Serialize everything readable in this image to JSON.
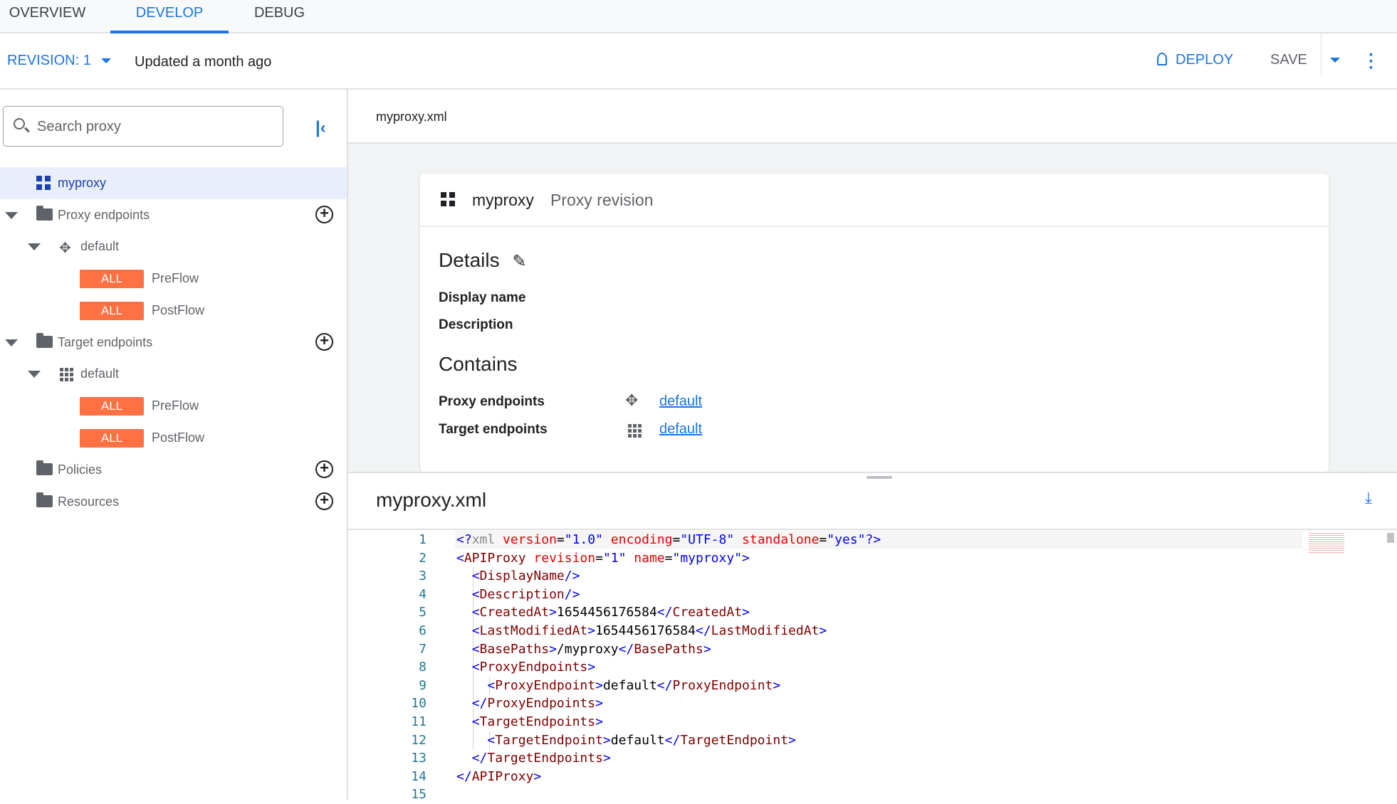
{
  "tabs": [
    {
      "label": "OVERVIEW"
    },
    {
      "label": "DEVELOP",
      "active": true
    },
    {
      "label": "DEBUG"
    }
  ],
  "header": {
    "revision": "REVISION: 1",
    "updated": "Updated a month ago",
    "deploy": "DEPLOY",
    "save": "SAVE"
  },
  "sidebar": {
    "search_placeholder": "Search proxy",
    "root": "myproxy",
    "proxy_endpoints": "Proxy endpoints",
    "proxy_default": "default",
    "target_endpoints": "Target endpoints",
    "target_default": "default",
    "badge": "ALL",
    "preflow": "PreFlow",
    "postflow": "PostFlow",
    "policies": "Policies",
    "resources": "Resources"
  },
  "file_tab": "myproxy.xml",
  "card": {
    "name": "myproxy",
    "subtitle": "Proxy revision",
    "details": "Details",
    "display_name": "Display name",
    "description": "Description",
    "contains": "Contains",
    "proxy_endpoints": "Proxy endpoints",
    "proxy_link": "default",
    "target_endpoints": "Target endpoints",
    "target_link": "default"
  },
  "editor": {
    "title": "myproxy.xml",
    "lines": [
      [
        [
          "d",
          "<?"
        ],
        [
          "p",
          "xml "
        ],
        [
          "a",
          "version"
        ],
        [
          "x",
          "="
        ],
        [
          "v",
          "\"1.0\""
        ],
        [
          "x",
          " "
        ],
        [
          "a",
          "encoding"
        ],
        [
          "x",
          "="
        ],
        [
          "v",
          "\"UTF-8\""
        ],
        [
          "x",
          " "
        ],
        [
          "a",
          "standalone"
        ],
        [
          "x",
          "="
        ],
        [
          "v",
          "\"yes\""
        ],
        [
          "d",
          "?>"
        ]
      ],
      [
        [
          "d",
          "<"
        ],
        [
          "t",
          "APIProxy "
        ],
        [
          "a",
          "revision"
        ],
        [
          "x",
          "="
        ],
        [
          "v",
          "\"1\""
        ],
        [
          "x",
          " "
        ],
        [
          "a",
          "name"
        ],
        [
          "x",
          "="
        ],
        [
          "v",
          "\"myproxy\""
        ],
        [
          "d",
          ">"
        ]
      ],
      [
        [
          "x",
          "  "
        ],
        [
          "d",
          "<"
        ],
        [
          "t",
          "DisplayName"
        ],
        [
          "d",
          "/>"
        ]
      ],
      [
        [
          "x",
          "  "
        ],
        [
          "d",
          "<"
        ],
        [
          "t",
          "Description"
        ],
        [
          "d",
          "/>"
        ]
      ],
      [
        [
          "x",
          "  "
        ],
        [
          "d",
          "<"
        ],
        [
          "t",
          "CreatedAt"
        ],
        [
          "d",
          ">"
        ],
        [
          "x",
          "1654456176584"
        ],
        [
          "d",
          "</"
        ],
        [
          "t",
          "CreatedAt"
        ],
        [
          "d",
          ">"
        ]
      ],
      [
        [
          "x",
          "  "
        ],
        [
          "d",
          "<"
        ],
        [
          "t",
          "LastModifiedAt"
        ],
        [
          "d",
          ">"
        ],
        [
          "x",
          "1654456176584"
        ],
        [
          "d",
          "</"
        ],
        [
          "t",
          "LastModifiedAt"
        ],
        [
          "d",
          ">"
        ]
      ],
      [
        [
          "x",
          "  "
        ],
        [
          "d",
          "<"
        ],
        [
          "t",
          "BasePaths"
        ],
        [
          "d",
          ">"
        ],
        [
          "x",
          "/myproxy"
        ],
        [
          "d",
          "</"
        ],
        [
          "t",
          "BasePaths"
        ],
        [
          "d",
          ">"
        ]
      ],
      [
        [
          "x",
          "  "
        ],
        [
          "d",
          "<"
        ],
        [
          "t",
          "ProxyEndpoints"
        ],
        [
          "d",
          ">"
        ]
      ],
      [
        [
          "x",
          "    "
        ],
        [
          "d",
          "<"
        ],
        [
          "t",
          "ProxyEndpoint"
        ],
        [
          "d",
          ">"
        ],
        [
          "x",
          "default"
        ],
        [
          "d",
          "</"
        ],
        [
          "t",
          "ProxyEndpoint"
        ],
        [
          "d",
          ">"
        ]
      ],
      [
        [
          "x",
          "  "
        ],
        [
          "d",
          "</"
        ],
        [
          "t",
          "ProxyEndpoints"
        ],
        [
          "d",
          ">"
        ]
      ],
      [
        [
          "x",
          "  "
        ],
        [
          "d",
          "<"
        ],
        [
          "t",
          "TargetEndpoints"
        ],
        [
          "d",
          ">"
        ]
      ],
      [
        [
          "x",
          "    "
        ],
        [
          "d",
          "<"
        ],
        [
          "t",
          "TargetEndpoint"
        ],
        [
          "d",
          ">"
        ],
        [
          "x",
          "default"
        ],
        [
          "d",
          "</"
        ],
        [
          "t",
          "TargetEndpoint"
        ],
        [
          "d",
          ">"
        ]
      ],
      [
        [
          "x",
          "  "
        ],
        [
          "d",
          "</"
        ],
        [
          "t",
          "TargetEndpoints"
        ],
        [
          "d",
          ">"
        ]
      ],
      [
        [
          "d",
          "</"
        ],
        [
          "t",
          "APIProxy"
        ],
        [
          "d",
          ">"
        ]
      ],
      []
    ]
  },
  "colors": {
    "accent": "#1a73e8",
    "badge": "#ff7043",
    "selected_row": "#e8eefb"
  }
}
